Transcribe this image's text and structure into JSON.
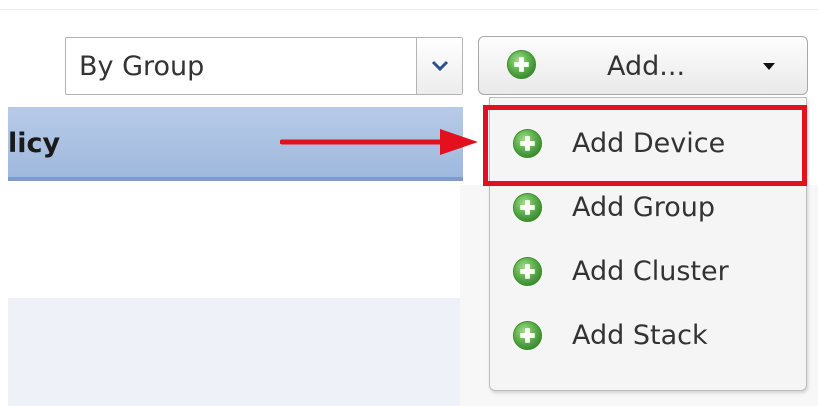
{
  "filter": {
    "selected": "By Group"
  },
  "add_button": {
    "label": "Add..."
  },
  "table": {
    "column_header": "licy"
  },
  "add_menu": {
    "items": [
      {
        "label": "Add Device",
        "icon": "plus-circle-icon"
      },
      {
        "label": "Add Group",
        "icon": "plus-circle-icon"
      },
      {
        "label": "Add Cluster",
        "icon": "plus-circle-icon"
      },
      {
        "label": "Add Stack",
        "icon": "plus-circle-icon"
      }
    ],
    "highlighted_item": "Add Device"
  },
  "colors": {
    "icon_green": "#5cb34a",
    "header_blue": "#a9c0e2",
    "annotation_red": "#e3101d",
    "chevron_blue": "#2c4f8f"
  }
}
